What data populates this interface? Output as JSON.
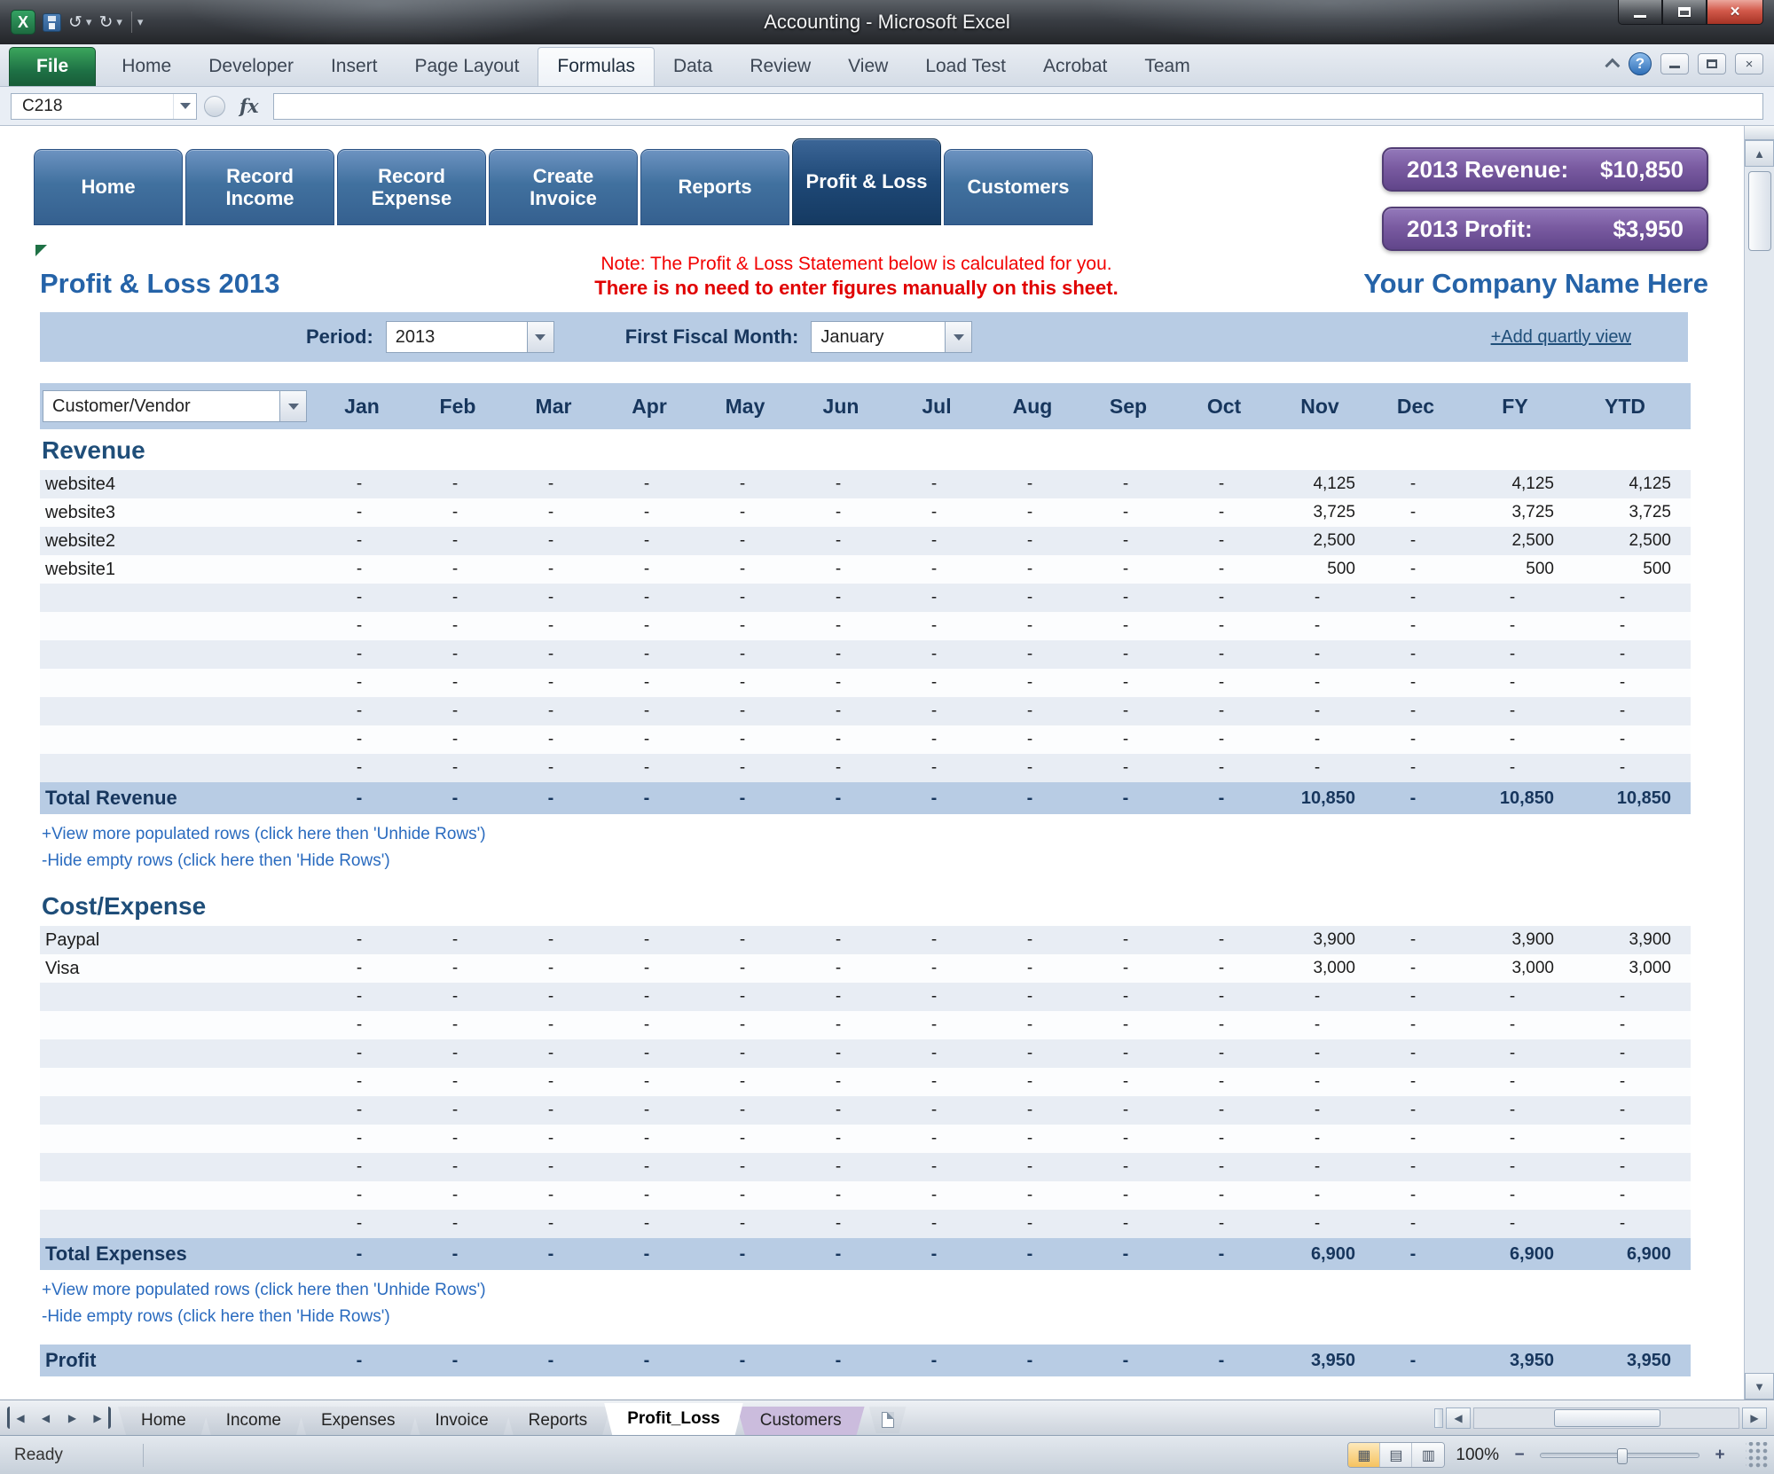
{
  "window": {
    "title": "Accounting - Microsoft Excel"
  },
  "ribbon": {
    "file_tab": "File",
    "tabs": [
      "Home",
      "Developer",
      "Insert",
      "Page Layout",
      "Formulas",
      "Data",
      "Review",
      "View",
      "Load Test",
      "Acrobat",
      "Team"
    ],
    "active_tab": "Formulas"
  },
  "formula_bar": {
    "name_box": "C218",
    "fx_label": "fx",
    "formula_value": ""
  },
  "nav": {
    "items": [
      {
        "label": "Home",
        "active": false
      },
      {
        "label": "Record Income",
        "active": false
      },
      {
        "label": "Record Expense",
        "active": false
      },
      {
        "label": "Create Invoice",
        "active": false
      },
      {
        "label": "Reports",
        "active": false
      },
      {
        "label": "Profit & Loss",
        "active": true
      },
      {
        "label": "Customers",
        "active": false
      }
    ]
  },
  "badges": [
    {
      "label": "2013 Revenue:",
      "value": "$10,850"
    },
    {
      "label": "2013 Profit:",
      "value": "$3,950"
    }
  ],
  "header": {
    "page_title": "Profit & Loss 2013",
    "note_line1": "Note: The Profit & Loss Statement below is calculated for you.",
    "note_line2": "There is no need to enter figures manually on this sheet.",
    "company_name": "Your Company Name Here"
  },
  "controls": {
    "period_label": "Period:",
    "period_value": "2013",
    "fiscal_label": "First Fiscal Month:",
    "fiscal_value": "January",
    "add_quarterly_link": "+Add quartly view",
    "vendor_filter": "Customer/Vendor"
  },
  "table": {
    "columns": [
      "Jan",
      "Feb",
      "Mar",
      "Apr",
      "May",
      "Jun",
      "Jul",
      "Aug",
      "Sep",
      "Oct",
      "Nov",
      "Dec",
      "FY",
      "YTD"
    ],
    "dash": "-",
    "sections": [
      {
        "heading": "Revenue",
        "rows": [
          {
            "label": "website4",
            "cells": [
              "-",
              "-",
              "-",
              "-",
              "-",
              "-",
              "-",
              "-",
              "-",
              "-",
              "4,125",
              "-",
              "4,125",
              "4,125"
            ]
          },
          {
            "label": "website3",
            "cells": [
              "-",
              "-",
              "-",
              "-",
              "-",
              "-",
              "-",
              "-",
              "-",
              "-",
              "3,725",
              "-",
              "3,725",
              "3,725"
            ]
          },
          {
            "label": "website2",
            "cells": [
              "-",
              "-",
              "-",
              "-",
              "-",
              "-",
              "-",
              "-",
              "-",
              "-",
              "2,500",
              "-",
              "2,500",
              "2,500"
            ]
          },
          {
            "label": "website1",
            "cells": [
              "-",
              "-",
              "-",
              "-",
              "-",
              "-",
              "-",
              "-",
              "-",
              "-",
              "500",
              "-",
              "500",
              "500"
            ]
          }
        ],
        "empty_row_count": 7,
        "total": {
          "label": "Total Revenue",
          "cells": [
            "-",
            "-",
            "-",
            "-",
            "-",
            "-",
            "-",
            "-",
            "-",
            "-",
            "10,850",
            "-",
            "10,850",
            "10,850"
          ]
        },
        "links": [
          "+View more populated rows (click here then 'Unhide Rows')",
          "-Hide empty rows (click here then 'Hide Rows')"
        ]
      },
      {
        "heading": "Cost/Expense",
        "rows": [
          {
            "label": "Paypal",
            "cells": [
              "-",
              "-",
              "-",
              "-",
              "-",
              "-",
              "-",
              "-",
              "-",
              "-",
              "3,900",
              "-",
              "3,900",
              "3,900"
            ]
          },
          {
            "label": "Visa",
            "cells": [
              "-",
              "-",
              "-",
              "-",
              "-",
              "-",
              "-",
              "-",
              "-",
              "-",
              "3,000",
              "-",
              "3,000",
              "3,000"
            ]
          }
        ],
        "empty_row_count": 9,
        "total": {
          "label": "Total Expenses",
          "cells": [
            "-",
            "-",
            "-",
            "-",
            "-",
            "-",
            "-",
            "-",
            "-",
            "-",
            "6,900",
            "-",
            "6,900",
            "6,900"
          ]
        },
        "links": [
          "+View more populated rows (click here then 'Unhide Rows')",
          "-Hide empty rows (click here then 'Hide Rows')"
        ]
      }
    ],
    "profit": {
      "label": "Profit",
      "cells": [
        "-",
        "-",
        "-",
        "-",
        "-",
        "-",
        "-",
        "-",
        "-",
        "-",
        "3,950",
        "-",
        "3,950",
        "3,950"
      ]
    }
  },
  "sheet_tabs": [
    {
      "label": "Home",
      "active": false
    },
    {
      "label": "Income",
      "active": false
    },
    {
      "label": "Expenses",
      "active": false
    },
    {
      "label": "Invoice",
      "active": false
    },
    {
      "label": "Reports",
      "active": false
    },
    {
      "label": "Profit_Loss",
      "active": true
    },
    {
      "label": "Customers",
      "active": false,
      "tint": "#cbbcdd"
    }
  ],
  "status_bar": {
    "status": "Ready",
    "zoom": "100%"
  },
  "icons": {
    "excel_logo": "X",
    "dropdown": "▾",
    "undo": "↺",
    "redo": "↻",
    "help": "?",
    "close": "×",
    "scroll_up": "▲",
    "scroll_down": "▼",
    "scroll_left": "◀",
    "scroll_right": "▶",
    "view_normal": "▦",
    "view_page_layout": "▤",
    "view_page_break": "▥",
    "zoom_out": "−",
    "zoom_in": "+"
  }
}
